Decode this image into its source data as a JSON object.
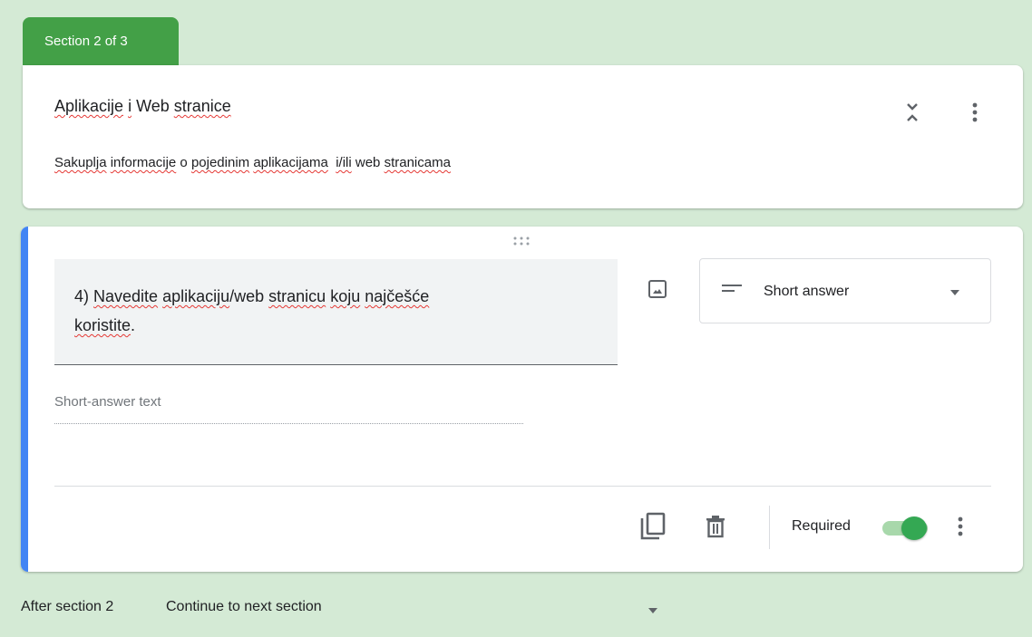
{
  "section_tab": "Section 2 of 3",
  "header": {
    "title_words": [
      "Aplikacije",
      " ",
      "i",
      " Web ",
      "stranice"
    ],
    "desc_words": [
      "Sakuplja",
      " ",
      "informacije",
      " o ",
      "pojedinim",
      " ",
      "aplikacijama",
      "  ",
      "i/ili",
      " web ",
      "stranicama"
    ]
  },
  "question": {
    "title_parts": [
      "4) ",
      "Navedite",
      " ",
      "aplikaciju",
      "/web ",
      "stranicu",
      " ",
      "koju",
      " ",
      "najčešće",
      " ",
      "koristite",
      "."
    ],
    "type": "Short answer",
    "answer_placeholder": "Short-answer text",
    "required_label": "Required",
    "required": true
  },
  "after_section": {
    "label": "After section 2",
    "value": "Continue to next section"
  },
  "colors": {
    "background": "#d4ead5",
    "section_tab": "#43a047",
    "accent": "#4285f4",
    "toggle_on": "#34a853"
  }
}
